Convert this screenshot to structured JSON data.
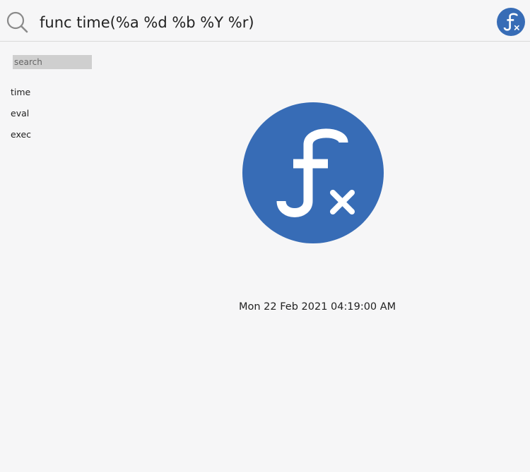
{
  "topbar": {
    "query": "func time(%a %d %b %Y %r)",
    "logo_icon": "function-fx-icon"
  },
  "sidebar": {
    "search_placeholder": "search",
    "items": [
      {
        "label": "time"
      },
      {
        "label": "eval"
      },
      {
        "label": "exec"
      }
    ]
  },
  "main": {
    "logo_icon": "function-fx-icon",
    "result": "Mon 22 Feb 2021 04:19:00 AM"
  },
  "colors": {
    "accent": "#376cb6",
    "background": "#f6f6f7",
    "search_field": "#cfcfcf"
  }
}
